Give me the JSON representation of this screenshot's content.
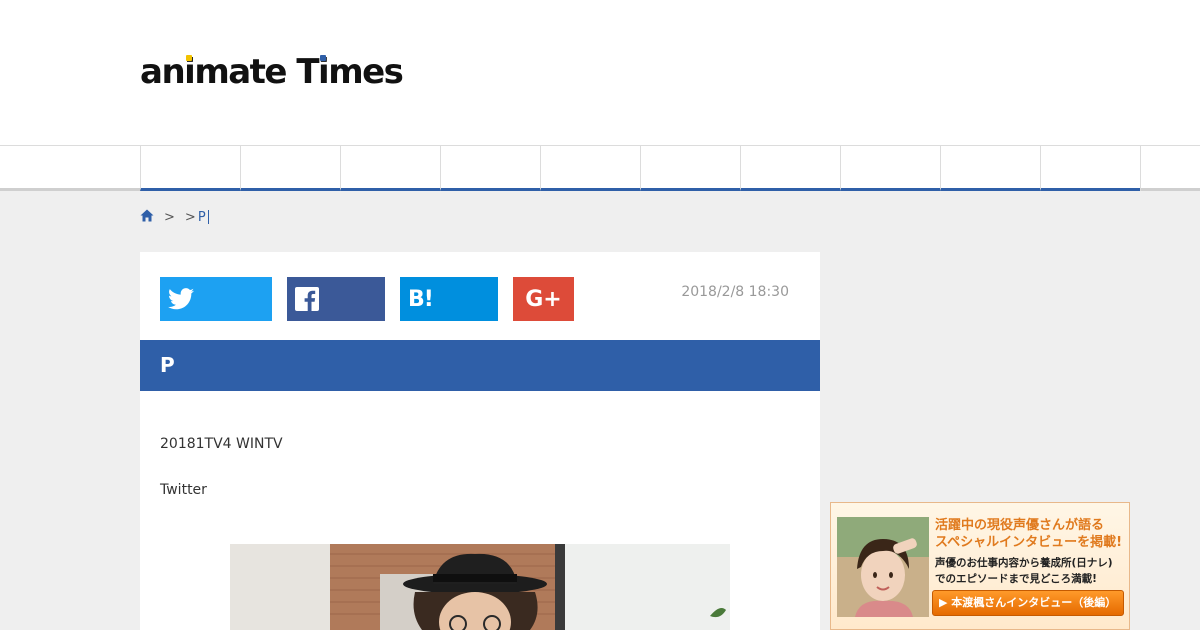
{
  "header": {
    "logo_text_1": "an",
    "logo_text_i": "i",
    "logo_text_2": "mate T",
    "logo_text_i2": "i",
    "logo_text_3": "mes"
  },
  "nav": {
    "item_count": 10
  },
  "breadcrumb": {
    "home_icon": "home-icon",
    "sep1": ">",
    "sep2": ">",
    "current": "P"
  },
  "share": {
    "twitter_icon": "twitter-icon",
    "facebook_icon": "facebook-icon",
    "hatena_label": "B!",
    "gplus_label": "G+"
  },
  "article": {
    "date": "2018/2/8 18:30",
    "title": "P",
    "paragraph_1": "20181TV4 WINTV",
    "paragraph_2": "Twitter"
  },
  "banner": {
    "headline_1": "活躍中の現役声優さんが語る",
    "headline_2": "スペシャルインタビューを掲載!",
    "sub_1": "声優のお仕事内容から養成所(日ナレ)",
    "sub_2": "でのエピソードまで見どころ満載!",
    "button_label": "▶ 本渡楓さんインタビュー（後編）"
  },
  "colors": {
    "brand_blue": "#2f5fa8",
    "twitter": "#1da1f2",
    "facebook": "#3b5998",
    "hatena": "#008fde",
    "gplus": "#dd4b39",
    "banner_orange": "#e07a1e"
  }
}
